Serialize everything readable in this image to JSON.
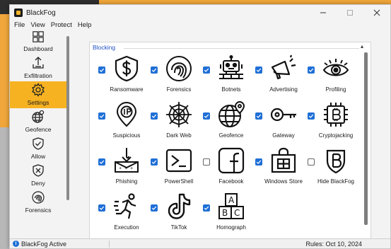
{
  "window": {
    "title": "BlackFog"
  },
  "menu": [
    "File",
    "View",
    "Protect",
    "Help"
  ],
  "sidebar": {
    "items": [
      {
        "label": "Dashboard",
        "icon": "dashboard-icon"
      },
      {
        "label": "Exfiltration",
        "icon": "exfiltration-icon"
      },
      {
        "label": "Settings",
        "icon": "gear-icon",
        "active": true
      },
      {
        "label": "Geofence",
        "icon": "globe-icon"
      },
      {
        "label": "Allow",
        "icon": "shield-check-icon"
      },
      {
        "label": "Deny",
        "icon": "shield-x-icon"
      },
      {
        "label": "Forensics",
        "icon": "fingerprint-icon"
      }
    ]
  },
  "blocking": {
    "title": "Blocking",
    "items": [
      {
        "label": "Ransomware",
        "checked": true,
        "icon": "ransom-shield-icon"
      },
      {
        "label": "Forensics",
        "checked": true,
        "icon": "fingerprint-icon"
      },
      {
        "label": "Botnets",
        "checked": true,
        "icon": "robot-icon"
      },
      {
        "label": "Advertising",
        "checked": true,
        "icon": "megaphone-icon"
      },
      {
        "label": "Profiling",
        "checked": true,
        "icon": "eye-icon"
      },
      {
        "label": "Suspicious",
        "checked": true,
        "icon": "ip-pin-icon"
      },
      {
        "label": "Dark Web",
        "checked": true,
        "icon": "spiderweb-icon"
      },
      {
        "label": "Geofence",
        "checked": true,
        "icon": "globe-pin-icon"
      },
      {
        "label": "Gateway",
        "checked": true,
        "icon": "key-icon"
      },
      {
        "label": "Cryptojacking",
        "checked": true,
        "icon": "bitcoin-chip-icon"
      },
      {
        "label": "Phishing",
        "checked": true,
        "icon": "phishing-hook-icon"
      },
      {
        "label": "PowerShell",
        "checked": true,
        "icon": "terminal-icon"
      },
      {
        "label": "Facebook",
        "checked": false,
        "icon": "facebook-icon"
      },
      {
        "label": "Windows Store",
        "checked": true,
        "icon": "store-bag-icon"
      },
      {
        "label": "Hide BlackFog",
        "checked": false,
        "icon": "blackfog-logo-icon"
      },
      {
        "label": "Execution",
        "checked": true,
        "icon": "running-person-icon"
      },
      {
        "label": "TikTok",
        "checked": true,
        "icon": "tiktok-icon"
      },
      {
        "label": "Homograph",
        "checked": true,
        "icon": "abc-blocks-icon"
      }
    ]
  },
  "status": {
    "text": "BlackFog Active",
    "rules": "Rules: Oct 10, 2024"
  },
  "colors": {
    "accent": "#f6b221",
    "checkbox": "#1f6fd6",
    "group_title": "#1f4fc4"
  }
}
